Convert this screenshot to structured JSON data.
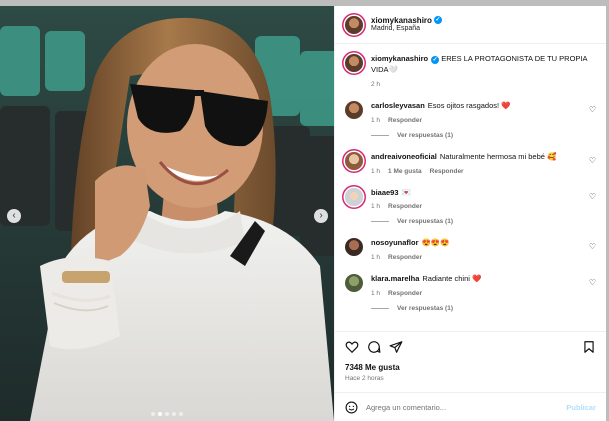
{
  "post": {
    "username": "xiomykanashiro",
    "location": "Madrid, España",
    "caption": "ERES LA PROTAGONISTA DE TU PROPIA VIDA🤍",
    "caption_time": "2 h",
    "likes": "7348 Me gusta",
    "posted": "Hace 2 horas",
    "comment_placeholder": "Agrega un comentario...",
    "publish_label": "Publicar",
    "more_icon": "more-icon"
  },
  "comments": [
    {
      "user": "carlosleyvasan",
      "text": "Esos ojitos rasgados! ❤️",
      "time": "1 h",
      "likes": "",
      "reply": "Responder",
      "view_replies": "Ver respuestas (1)"
    },
    {
      "user": "andreaivoneoficial",
      "text": "Naturalmente hermosa mi bebé 🥰",
      "time": "1 h",
      "likes": "1 Me gusta",
      "reply": "Responder",
      "view_replies": ""
    },
    {
      "user": "biaae93",
      "text": "💌",
      "time": "1 h",
      "likes": "",
      "reply": "Responder",
      "view_replies": "Ver respuestas (1)"
    },
    {
      "user": "nosoyunaflor",
      "text": "😍😍😍",
      "time": "1 h",
      "likes": "",
      "reply": "Responder",
      "view_replies": ""
    },
    {
      "user": "klara.marelha",
      "text": "Radiante chini ❤️",
      "time": "1 h",
      "likes": "",
      "reply": "Responder",
      "view_replies": "Ver respuestas (1)"
    }
  ],
  "colors": {
    "verified": "#0095f6",
    "publish": "#b2dffc",
    "muted": "#737373"
  },
  "carousel": {
    "active_index": 1,
    "count": 5
  }
}
